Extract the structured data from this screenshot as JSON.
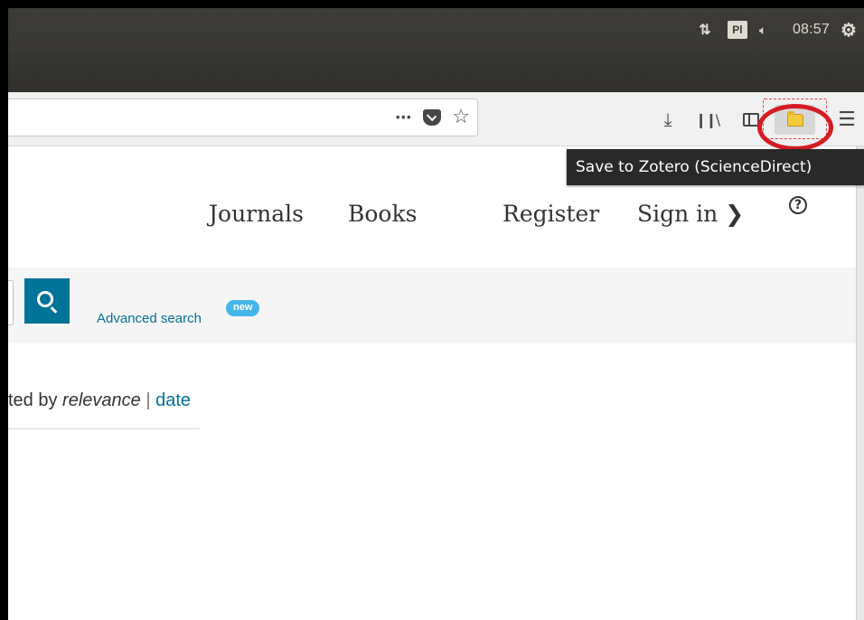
{
  "system_panel": {
    "keyboard_layout": "Pl",
    "clock": "08:57",
    "icons": [
      "network-arrows-icon",
      "keyboard-layout-icon",
      "volume-icon",
      "settings-gear-icon"
    ]
  },
  "browser": {
    "url_bar_actions": {
      "page_actions": "⋯",
      "pocket": "pocket-icon",
      "bookmark": "☆"
    },
    "toolbar": {
      "download": "⤓",
      "library": "❙❙\\",
      "menu": "☰"
    },
    "zotero_tooltip": "Save to Zotero (ScienceDirect)",
    "highlight_color": "#d61c22"
  },
  "site": {
    "nav": {
      "journals": "Journals",
      "books": "Books",
      "register": "Register",
      "sign_in": "Sign in ❯",
      "help": "?"
    },
    "search": {
      "advanced": "Advanced search",
      "new_badge": "new"
    },
    "sort": {
      "prefix": "ted by ",
      "relevance": "relevance",
      "separator": "|",
      "date": "date"
    },
    "accent_color": "#007398"
  }
}
